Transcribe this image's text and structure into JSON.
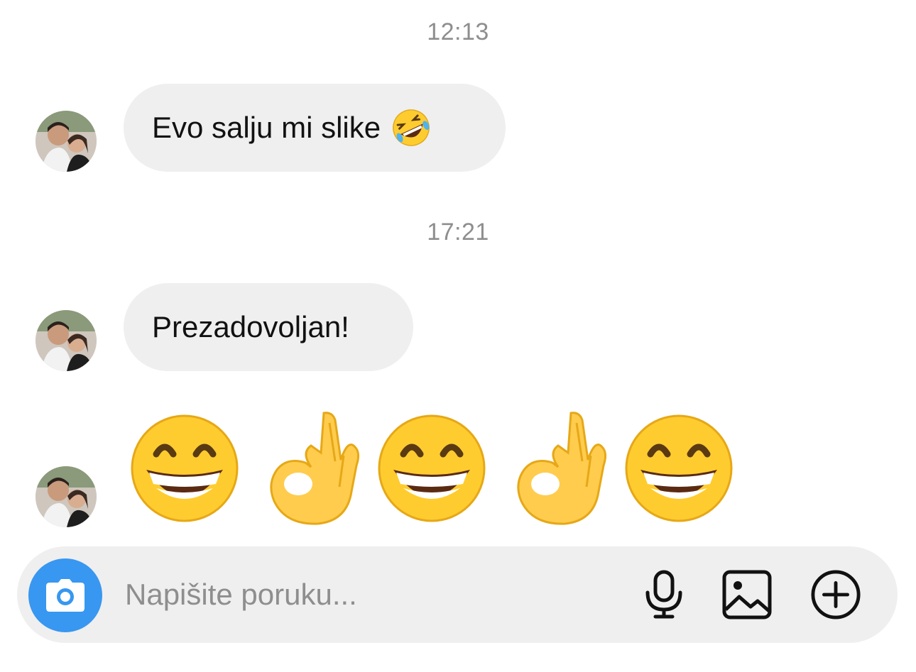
{
  "thread": {
    "timestamps": [
      "12:13",
      "17:21"
    ],
    "messages": [
      {
        "text": "Evo salju mi slike",
        "emoji": "rolling-on-floor-laughing"
      },
      {
        "text": "Prezadovoljan!"
      }
    ],
    "emoji_message": [
      "grinning-face",
      "ok-hand",
      "grinning-face",
      "ok-hand",
      "grinning-face"
    ]
  },
  "composer": {
    "placeholder": "Napišite poruku...",
    "camera_icon": "camera-icon",
    "mic_icon": "microphone-icon",
    "image_icon": "image-icon",
    "plus_icon": "plus-circle-icon"
  },
  "colors": {
    "accent": "#3897f0",
    "bubble_bg": "#efefef",
    "timestamp": "#8e8e8e",
    "emoji_yellow": "#ffcc2f"
  }
}
